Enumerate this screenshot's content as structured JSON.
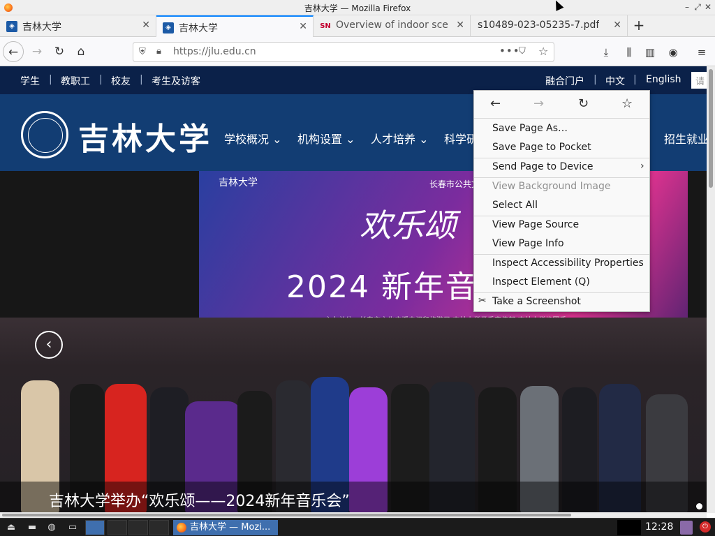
{
  "window": {
    "title": "吉林大学 — Mozilla Firefox",
    "controls": [
      "–",
      "⤢",
      "✕"
    ]
  },
  "tabs": [
    {
      "label": "吉林大学",
      "active": false,
      "favicon": "university-favicon"
    },
    {
      "label": "吉林大学",
      "active": true,
      "favicon": "university-favicon"
    },
    {
      "label": "Overview of indoor scen",
      "active": false,
      "favicon": "springer-favicon",
      "favicon_text": "SN"
    },
    {
      "label": "s10489-023-05235-7.pdf",
      "active": false,
      "favicon": "none"
    }
  ],
  "tab_close_glyph": "✕",
  "new_tab_glyph": "+",
  "nav": {
    "back_glyph": "←",
    "forward_glyph": "→",
    "reload_glyph": "↻",
    "home_glyph": "⌂",
    "url": "https://jlu.edu.cn",
    "page_actions_glyph": "•••",
    "pocket_glyph": "⛉",
    "bookmark_glyph": "☆",
    "download_glyph": "⤓",
    "library_glyph": "⫼",
    "sidebar_glyph": "▥",
    "account_glyph": "◉",
    "menu_glyph": "≡"
  },
  "site": {
    "top_links": [
      "学生",
      "教职工",
      "校友",
      "考生及访客"
    ],
    "top_sep": "|",
    "top_right": [
      "融合门户",
      "中文",
      "English"
    ],
    "search_placeholder": "请",
    "logo_text": "吉林大学",
    "main_nav": [
      "学校概况 ⌄",
      "机构设置 ⌄",
      "人才培养 ⌄",
      "科学研",
      "招生就业"
    ],
    "hero": {
      "banner_org": "吉林大学",
      "banner_city": "长春市公共文化",
      "banner_script": "欢乐颂",
      "banner_headline": "2024 新年音",
      "banner_sponsors": "主办单位：长春市文化广播电视和旅游局  吉林大学党委宣传部  吉林大学校团委",
      "prev_glyph": "‹",
      "caption": "吉林大学举办“欢乐颂——2024新年音乐会”"
    }
  },
  "context_menu": {
    "nav_glyphs": {
      "back": "←",
      "forward": "→",
      "reload": "↻",
      "bookmark": "☆"
    },
    "items": [
      "Save Page As…",
      "Save Page to Pocket",
      "Send Page to Device",
      "View Background Image",
      "Select All",
      "View Page Source",
      "View Page Info",
      "Inspect Accessibility Properties",
      "Inspect Element (Q)",
      "Take a Screenshot"
    ],
    "submenu_glyph": "›",
    "screenshot_icon_glyph": "✂"
  },
  "taskbar": {
    "task_label": "吉林大学 — Mozi...",
    "clock": "12:28",
    "launcher_glyphs": [
      "⏏",
      "▬",
      "◍",
      "▭"
    ],
    "power_glyph": "⏻"
  },
  "colors": {
    "topbar_bg": "#0b2149",
    "header_bg": "#123d73",
    "tab_accent": "#0a84ff",
    "taskbar_task": "#3f6fae"
  }
}
